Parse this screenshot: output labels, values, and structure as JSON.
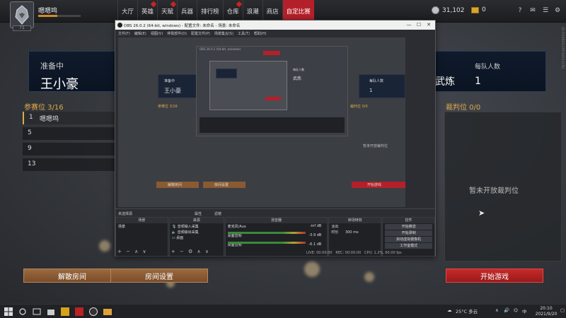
{
  "game": {
    "username": "嗯嗯呜",
    "avatar_level": "71",
    "nav": [
      "大厅",
      "英雄",
      "天赋",
      "兵器",
      "排行榜",
      "仓库",
      "浪潮",
      "商店",
      "自定比赛"
    ],
    "currency_silver": "31,102",
    "currency_gold": "0",
    "side_id": "ID:5509012451651(CN)",
    "prep_label": "准备中",
    "prep_name": "王小豪",
    "mode_text": "武炼",
    "team_label": "每队人数",
    "team_value": "1",
    "contest_title": "参赛位 3/16",
    "slots": [
      {
        "num": "1",
        "name": "嗯嗯呜"
      },
      {
        "num": "5",
        "name": ""
      },
      {
        "num": "9",
        "name": ""
      },
      {
        "num": "13",
        "name": ""
      }
    ],
    "judge_title": "裁判位 0/0",
    "judge_empty": "暂未开放裁判位",
    "btn_disband": "解散房间",
    "btn_settings": "房间设置",
    "btn_start": "开始游戏"
  },
  "obs": {
    "title": "OBS 26.0.2 (64-bit, windows) - 配置文件: 未命名 - 场景: 未命名",
    "menu": [
      "文件(F)",
      "编辑(E)",
      "视图(V)",
      "停靠部件(D)",
      "配置文件(P)",
      "场景集合(S)",
      "工具(T)",
      "帮助(H)"
    ],
    "no_source": "未选择源",
    "props": "属性",
    "filters": "滤镜",
    "docks": {
      "scenes_head": "场景",
      "scene_item": "场景",
      "sources_head": "来源",
      "sources": [
        "音频输入采集",
        "音频输出采集",
        "桌面"
      ],
      "mixer_head": "混音器",
      "mixer": [
        {
          "name": "麦克风/Aux",
          "db": "-inf dB"
        },
        {
          "name": "桌面音频",
          "db": "-3.9 dB"
        },
        {
          "name": "桌面音频",
          "db": "-6.1 dB"
        }
      ],
      "trans_head": "转场特效",
      "trans_type": "淡出",
      "trans_duration_label": "时长",
      "trans_duration": "300 ms",
      "controls_head": "控件",
      "controls": [
        "开始推流",
        "开始录制",
        "启动虚拟摄像机",
        "工作室模式",
        "设置",
        "退出"
      ]
    },
    "status": {
      "live": "LIVE: 00:00:00",
      "rec": "REC: 00:00:00",
      "cpu": "CPU: 1.2%, 60.00 fps"
    },
    "preview": {
      "prep": "准备中",
      "name": "王小豪",
      "team": "每队人数",
      "team_val": "1",
      "mode": "武炼",
      "judge": "裁判位 0/0",
      "judge_empty": "暂未开放裁判位",
      "disband": "解散房间",
      "settings": "房间设置",
      "start": "开始游戏",
      "contest": "参赛位 3/16",
      "nested_title": "OBS 26.0.2 (64-bit, windows)"
    }
  },
  "taskbar": {
    "weather": "25°C 多云",
    "time": "20:10",
    "date": "2021/9/20",
    "lang": "中"
  },
  "colors": {
    "accent_red": "#b4202a",
    "gold_text": "#e0a84a",
    "brown_button": "#8a5a33"
  }
}
